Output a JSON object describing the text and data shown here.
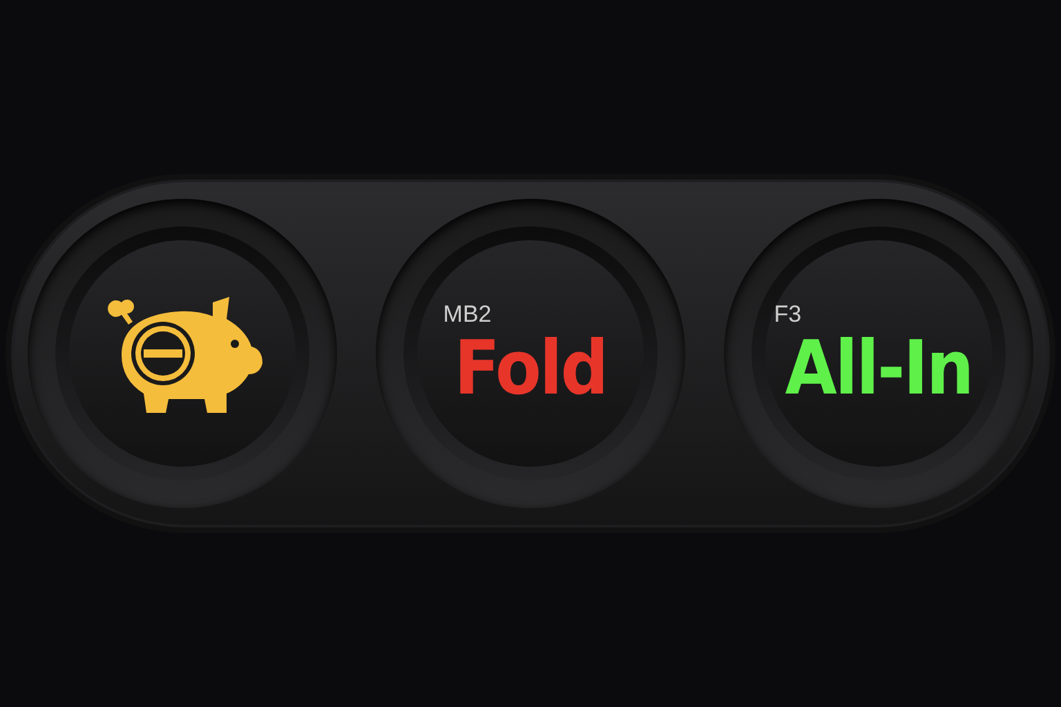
{
  "buttons": [
    {
      "kind": "icon",
      "color": "#f5bd3c"
    },
    {
      "kind": "text",
      "shortcut": "MB2",
      "label": "Fold",
      "color": "#e8352a"
    },
    {
      "kind": "text",
      "shortcut": "F3",
      "label": "All-In",
      "color": "#5ff04a"
    }
  ]
}
